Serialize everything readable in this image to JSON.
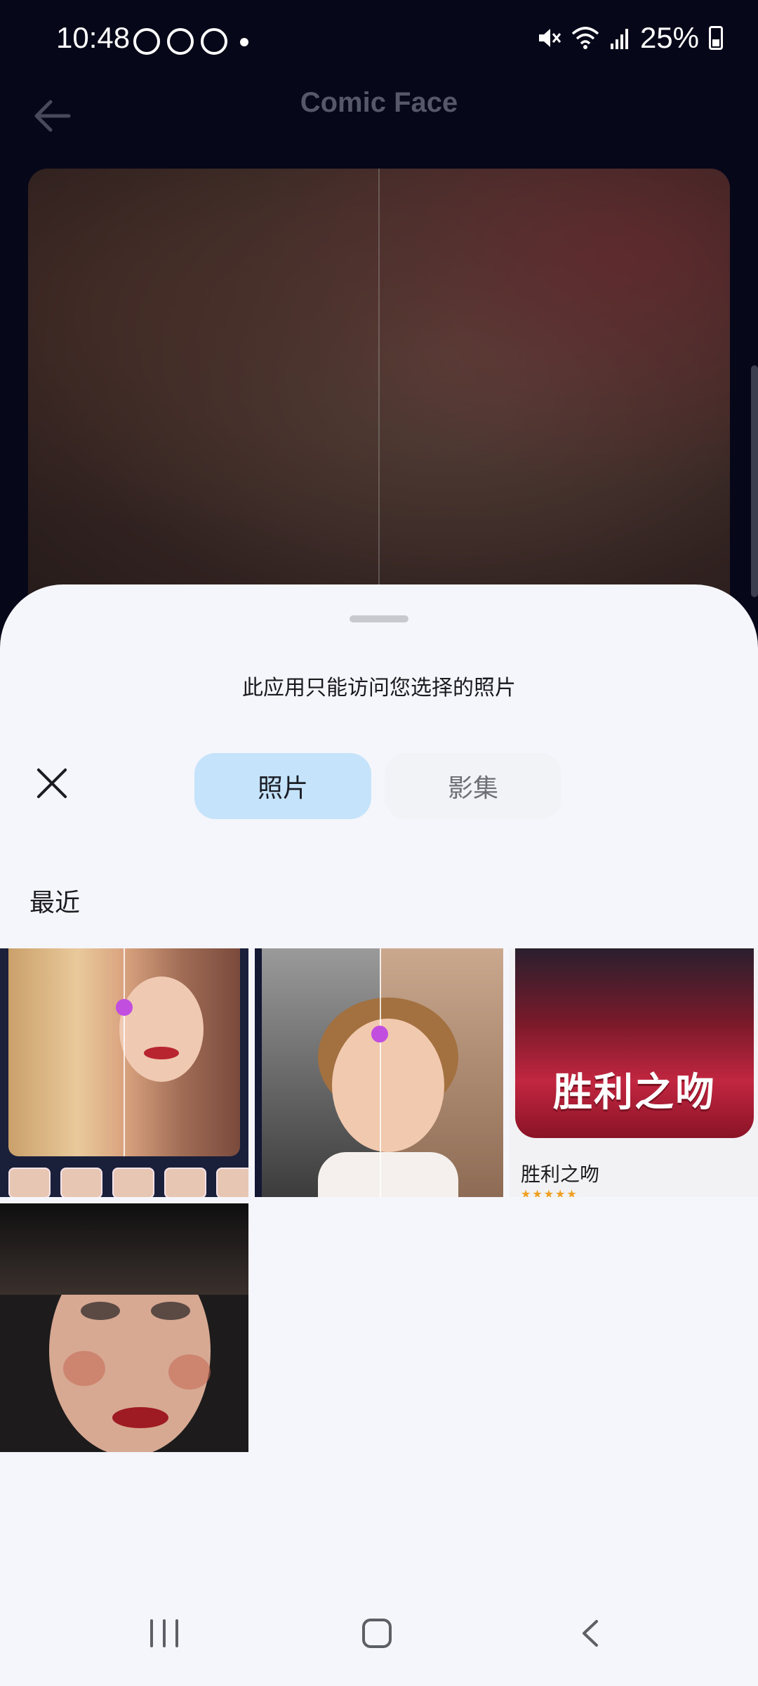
{
  "status_bar": {
    "time": "10:48",
    "battery": "25%",
    "left_icons": [
      "messenger-icon",
      "messenger-icon",
      "heart-app-icon"
    ],
    "right_icons": [
      "mute-icon",
      "wifi-icon",
      "signal-icon",
      "battery-charging-icon"
    ]
  },
  "app": {
    "title": "Comic Face"
  },
  "sheet": {
    "notice": "此应用只能访问您选择的照片",
    "tabs": [
      {
        "label": "照片",
        "selected": true
      },
      {
        "label": "影集",
        "selected": false
      }
    ],
    "section_title": "最近",
    "tiles": [
      {
        "kind": "photo",
        "icon": "comic-face-before-after"
      },
      {
        "kind": "photo",
        "icon": "colorized-family-photo"
      },
      {
        "kind": "app-card",
        "app_name": "胜利之吻",
        "banner_text": "胜利之吻",
        "stars": "★★★★★"
      },
      {
        "kind": "photo",
        "icon": "portrait-with-flower-makeup"
      }
    ]
  },
  "colors": {
    "tab_selected_bg": "#c5e3fb",
    "tab_unselected_bg": "#f2f3f6",
    "sheet_bg": "#f5f6fb",
    "backdrop": "#06081a"
  }
}
